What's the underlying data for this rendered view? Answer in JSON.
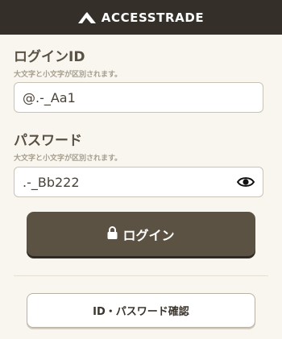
{
  "header": {
    "brand_name": "ACCESSTRADE",
    "logo_icon": "mountain-logo-icon"
  },
  "login_id": {
    "label": "ログインID",
    "hint": "大文字と小文字が区別されます。",
    "value": "@.-_Aa1"
  },
  "password": {
    "label": "パスワード",
    "hint": "大文字と小文字が区別されます。",
    "value": ".-_Bb222",
    "toggle_icon": "eye-icon"
  },
  "buttons": {
    "login_label": "ログイン",
    "login_icon": "lock-icon",
    "confirm_label": "ID・パスワード確認"
  },
  "colors": {
    "header_bg": "#342f29",
    "page_bg": "#f8f6ef",
    "login_button": "#5b5243",
    "label_text": "#5a5145"
  }
}
